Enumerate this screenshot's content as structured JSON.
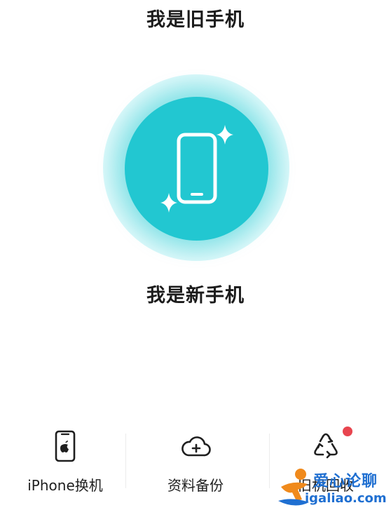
{
  "titles": {
    "old_phone": "我是旧手机",
    "new_phone": "我是新手机"
  },
  "colors": {
    "accent": "#22c7d1",
    "badge": "#e8454f",
    "text": "#1b1b1b"
  },
  "bottom_bar": {
    "items": [
      {
        "label": "iPhone换机",
        "icon": "iphone-icon"
      },
      {
        "label": "资料备份",
        "icon": "cloud-upload-icon"
      },
      {
        "label": "旧机回收",
        "icon": "recycle-icon",
        "has_badge": true
      }
    ]
  },
  "watermark": {
    "text": "爱心论聊",
    "url": "igaliao.com"
  }
}
